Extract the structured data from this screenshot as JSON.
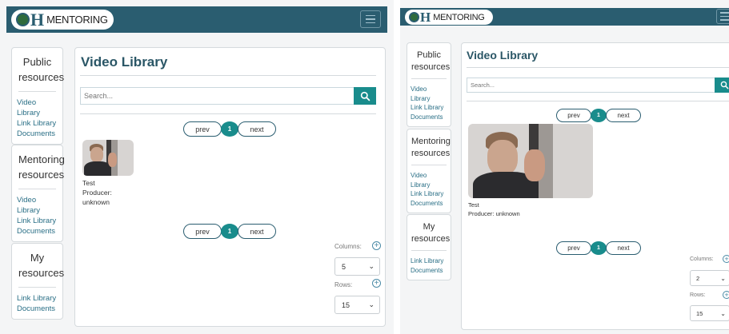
{
  "app": {
    "logo_letters": "H",
    "logo_text": "MENTORING"
  },
  "sidebar": {
    "public": {
      "title": "Public resources",
      "links": [
        "Video Library",
        "Link Library",
        "Documents"
      ]
    },
    "mentoring": {
      "title": "Mentoring resources",
      "links": [
        "Video Library",
        "Link Library",
        "Documents"
      ]
    },
    "my": {
      "title": "My resources",
      "links": [
        "Link Library",
        "Documents"
      ]
    }
  },
  "main": {
    "title": "Video Library",
    "search": {
      "placeholder": "Search..."
    },
    "pagination": {
      "prev": "prev",
      "current": "1",
      "next": "next"
    },
    "videos": [
      {
        "title": "Test",
        "producer": "Producer: unknown"
      }
    ],
    "controls": {
      "columns_label": "Columns:",
      "rows_label": "Rows:",
      "plus": "+",
      "caret": "⌄"
    }
  },
  "view_a": {
    "columns": "5",
    "rows": "15"
  },
  "view_b": {
    "columns": "2",
    "rows": "15"
  },
  "icons": {
    "search": "search-icon",
    "menu": "hamburger-menu-icon",
    "add": "plus-circle-icon",
    "dropdown": "chevron-down-icon"
  },
  "colors": {
    "topbar": "#2a5d70",
    "accent": "#198c8c",
    "link": "#2a6f86",
    "title": "#2a5666"
  }
}
